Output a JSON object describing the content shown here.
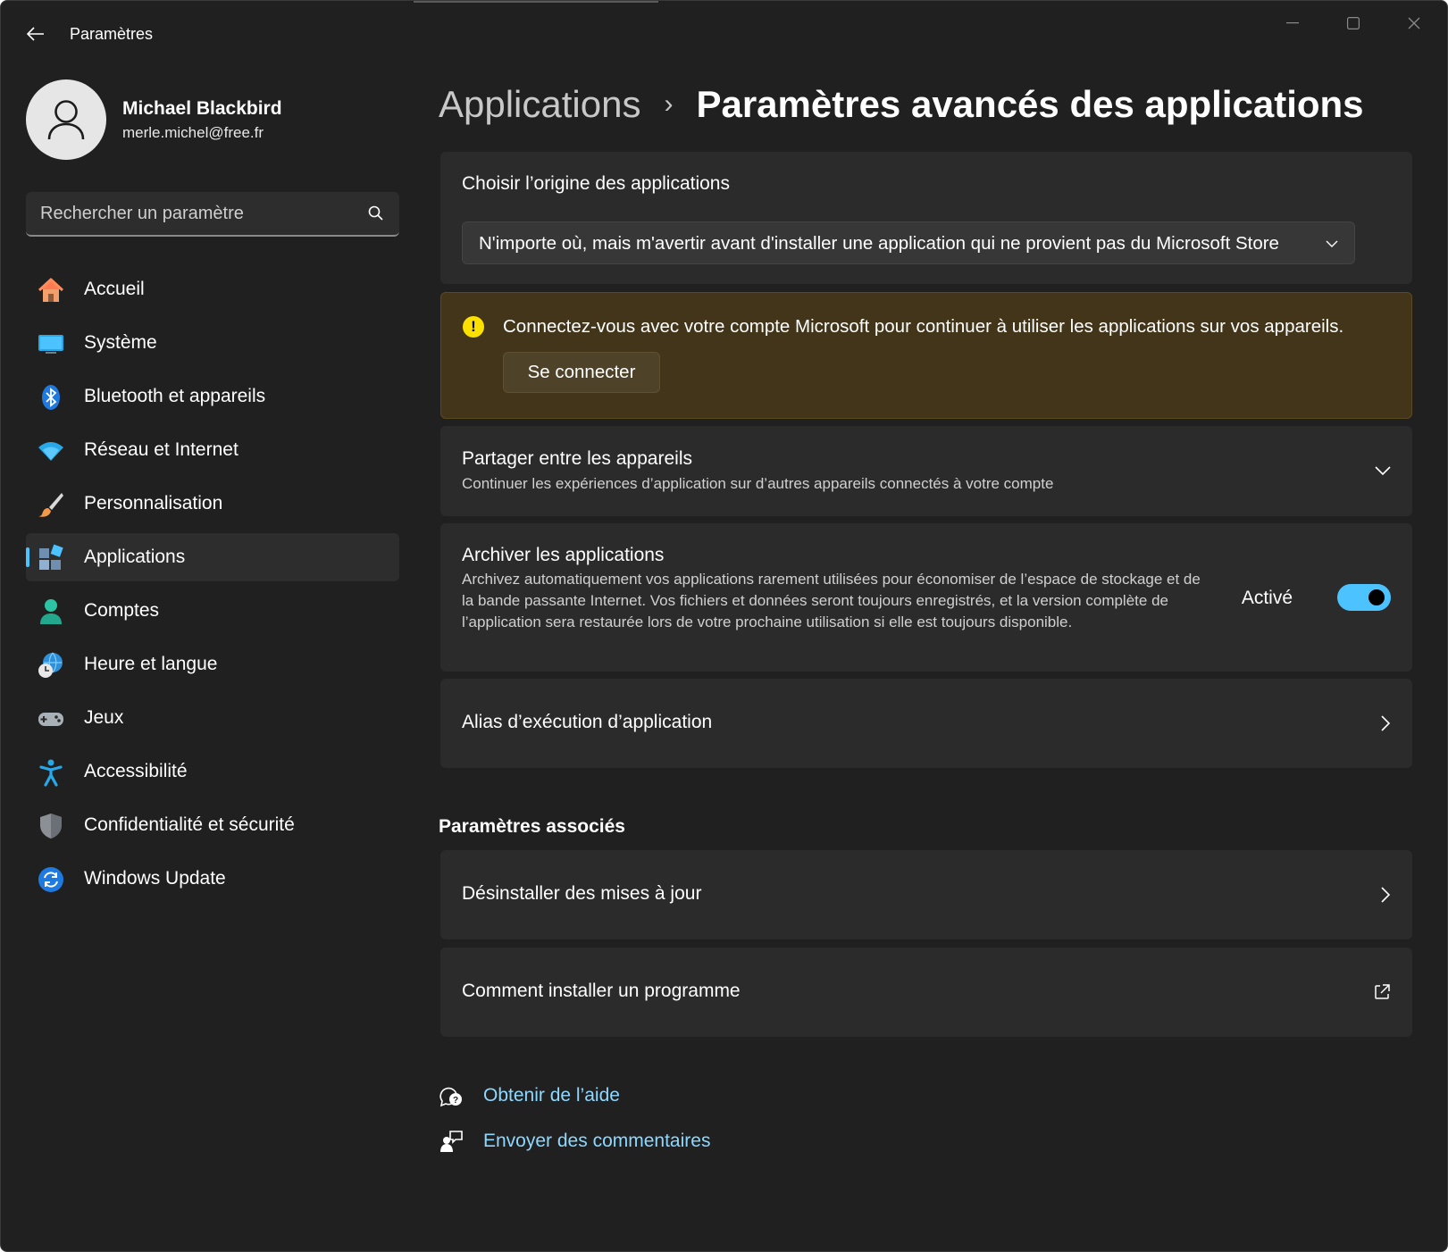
{
  "window": {
    "title": "Paramètres"
  },
  "user": {
    "name": "Michael Blackbird",
    "email": "merle.michel@free.fr"
  },
  "search": {
    "placeholder": "Rechercher un paramètre"
  },
  "sidebar": {
    "items": [
      {
        "label": "Accueil",
        "icon": "home-icon"
      },
      {
        "label": "Système",
        "icon": "system-icon"
      },
      {
        "label": "Bluetooth et appareils",
        "icon": "bluetooth-icon"
      },
      {
        "label": "Réseau et Internet",
        "icon": "wifi-icon"
      },
      {
        "label": "Personnalisation",
        "icon": "brush-icon"
      },
      {
        "label": "Applications",
        "icon": "apps-icon",
        "active": true
      },
      {
        "label": "Comptes",
        "icon": "person-icon"
      },
      {
        "label": "Heure et langue",
        "icon": "globe-clock-icon"
      },
      {
        "label": "Jeux",
        "icon": "gamepad-icon"
      },
      {
        "label": "Accessibilité",
        "icon": "accessibility-icon"
      },
      {
        "label": "Confidentialité et sécurité",
        "icon": "shield-icon"
      },
      {
        "label": "Windows Update",
        "icon": "update-icon"
      }
    ]
  },
  "breadcrumb": {
    "parent": "Applications",
    "separator": "›",
    "current": "Paramètres avancés des applications"
  },
  "app_source": {
    "title": "Choisir l’origine des applications",
    "selected": "N'importe où, mais m'avertir avant d'installer une application qui ne provient pas du Microsoft Store"
  },
  "warning": {
    "icon_text": "!",
    "text": "Connectez-vous avec votre compte Microsoft pour continuer à utiliser les applications sur vos appareils.",
    "button": "Se connecter"
  },
  "share": {
    "title": "Partager entre les appareils",
    "description": "Continuer les expériences d’application sur d’autres appareils connectés à votre compte"
  },
  "archive": {
    "title": "Archiver les applications",
    "description": "Archivez automatiquement vos applications rarement utilisées pour économiser de l’espace de stockage et de la bande passante Internet. Vos fichiers et données seront toujours enregistrés, et la version complète de l’application sera restaurée lors de votre prochaine utilisation si elle est toujours disponible.",
    "state_label": "Activé",
    "enabled": true
  },
  "alias": {
    "title": "Alias d’exécution d’application"
  },
  "related": {
    "title": "Paramètres associés",
    "uninstall": "Désinstaller des mises à jour",
    "howto": "Comment installer un programme"
  },
  "help": {
    "get_help": "Obtenir de l’aide",
    "feedback": "Envoyer des commentaires"
  },
  "colors": {
    "accent": "#4cc2ff",
    "warning_bg": "#433519",
    "warning_icon": "#fce100",
    "background": "#202020",
    "card": "#2b2b2b"
  }
}
